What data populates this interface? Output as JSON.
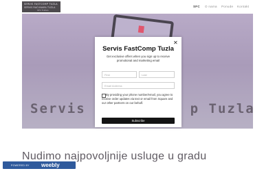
{
  "header": {
    "logo": {
      "line1": "SERVIS FASTCOMP TUZLA",
      "line2": "SERVIS RAČUNARA TUZLA",
      "line3": "SFC TUZLA"
    },
    "nav": [
      "SFC",
      "O nama",
      "Ponude",
      "Kontakt"
    ]
  },
  "hero": {
    "left_text": "Servis",
    "right_text": "p Tuzla",
    "accent_color": "#e0566e"
  },
  "section_title": "Nudimo najpovoljnije usluge u gradu",
  "footer_badge": {
    "powered_by": "POWERED BY",
    "brand": "weebly"
  },
  "modal": {
    "close_glyph": "✕",
    "title": "Servis FastComp Tuzla",
    "description": "Get exclusive offers when you sign up to receive promotional and marketing email",
    "first_placeholder": "First",
    "last_placeholder": "Last",
    "email_placeholder": "Email Address",
    "consent": "By providing your phone number/email, you agree to receive order updates via text or email from Square and our other partners on our behalf.",
    "button": "Subscribe"
  }
}
